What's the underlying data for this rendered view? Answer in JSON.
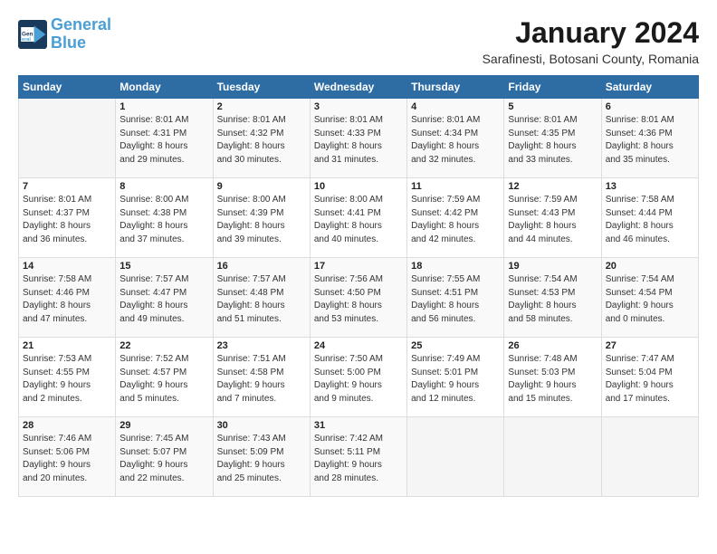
{
  "header": {
    "logo_line1": "General",
    "logo_line2": "Blue",
    "month_title": "January 2024",
    "subtitle": "Sarafinesti, Botosani County, Romania"
  },
  "weekdays": [
    "Sunday",
    "Monday",
    "Tuesday",
    "Wednesday",
    "Thursday",
    "Friday",
    "Saturday"
  ],
  "weeks": [
    [
      {
        "day": "",
        "info": ""
      },
      {
        "day": "1",
        "info": "Sunrise: 8:01 AM\nSunset: 4:31 PM\nDaylight: 8 hours\nand 29 minutes."
      },
      {
        "day": "2",
        "info": "Sunrise: 8:01 AM\nSunset: 4:32 PM\nDaylight: 8 hours\nand 30 minutes."
      },
      {
        "day": "3",
        "info": "Sunrise: 8:01 AM\nSunset: 4:33 PM\nDaylight: 8 hours\nand 31 minutes."
      },
      {
        "day": "4",
        "info": "Sunrise: 8:01 AM\nSunset: 4:34 PM\nDaylight: 8 hours\nand 32 minutes."
      },
      {
        "day": "5",
        "info": "Sunrise: 8:01 AM\nSunset: 4:35 PM\nDaylight: 8 hours\nand 33 minutes."
      },
      {
        "day": "6",
        "info": "Sunrise: 8:01 AM\nSunset: 4:36 PM\nDaylight: 8 hours\nand 35 minutes."
      }
    ],
    [
      {
        "day": "7",
        "info": "Sunrise: 8:01 AM\nSunset: 4:37 PM\nDaylight: 8 hours\nand 36 minutes."
      },
      {
        "day": "8",
        "info": "Sunrise: 8:00 AM\nSunset: 4:38 PM\nDaylight: 8 hours\nand 37 minutes."
      },
      {
        "day": "9",
        "info": "Sunrise: 8:00 AM\nSunset: 4:39 PM\nDaylight: 8 hours\nand 39 minutes."
      },
      {
        "day": "10",
        "info": "Sunrise: 8:00 AM\nSunset: 4:41 PM\nDaylight: 8 hours\nand 40 minutes."
      },
      {
        "day": "11",
        "info": "Sunrise: 7:59 AM\nSunset: 4:42 PM\nDaylight: 8 hours\nand 42 minutes."
      },
      {
        "day": "12",
        "info": "Sunrise: 7:59 AM\nSunset: 4:43 PM\nDaylight: 8 hours\nand 44 minutes."
      },
      {
        "day": "13",
        "info": "Sunrise: 7:58 AM\nSunset: 4:44 PM\nDaylight: 8 hours\nand 46 minutes."
      }
    ],
    [
      {
        "day": "14",
        "info": "Sunrise: 7:58 AM\nSunset: 4:46 PM\nDaylight: 8 hours\nand 47 minutes."
      },
      {
        "day": "15",
        "info": "Sunrise: 7:57 AM\nSunset: 4:47 PM\nDaylight: 8 hours\nand 49 minutes."
      },
      {
        "day": "16",
        "info": "Sunrise: 7:57 AM\nSunset: 4:48 PM\nDaylight: 8 hours\nand 51 minutes."
      },
      {
        "day": "17",
        "info": "Sunrise: 7:56 AM\nSunset: 4:50 PM\nDaylight: 8 hours\nand 53 minutes."
      },
      {
        "day": "18",
        "info": "Sunrise: 7:55 AM\nSunset: 4:51 PM\nDaylight: 8 hours\nand 56 minutes."
      },
      {
        "day": "19",
        "info": "Sunrise: 7:54 AM\nSunset: 4:53 PM\nDaylight: 8 hours\nand 58 minutes."
      },
      {
        "day": "20",
        "info": "Sunrise: 7:54 AM\nSunset: 4:54 PM\nDaylight: 9 hours\nand 0 minutes."
      }
    ],
    [
      {
        "day": "21",
        "info": "Sunrise: 7:53 AM\nSunset: 4:55 PM\nDaylight: 9 hours\nand 2 minutes."
      },
      {
        "day": "22",
        "info": "Sunrise: 7:52 AM\nSunset: 4:57 PM\nDaylight: 9 hours\nand 5 minutes."
      },
      {
        "day": "23",
        "info": "Sunrise: 7:51 AM\nSunset: 4:58 PM\nDaylight: 9 hours\nand 7 minutes."
      },
      {
        "day": "24",
        "info": "Sunrise: 7:50 AM\nSunset: 5:00 PM\nDaylight: 9 hours\nand 9 minutes."
      },
      {
        "day": "25",
        "info": "Sunrise: 7:49 AM\nSunset: 5:01 PM\nDaylight: 9 hours\nand 12 minutes."
      },
      {
        "day": "26",
        "info": "Sunrise: 7:48 AM\nSunset: 5:03 PM\nDaylight: 9 hours\nand 15 minutes."
      },
      {
        "day": "27",
        "info": "Sunrise: 7:47 AM\nSunset: 5:04 PM\nDaylight: 9 hours\nand 17 minutes."
      }
    ],
    [
      {
        "day": "28",
        "info": "Sunrise: 7:46 AM\nSunset: 5:06 PM\nDaylight: 9 hours\nand 20 minutes."
      },
      {
        "day": "29",
        "info": "Sunrise: 7:45 AM\nSunset: 5:07 PM\nDaylight: 9 hours\nand 22 minutes."
      },
      {
        "day": "30",
        "info": "Sunrise: 7:43 AM\nSunset: 5:09 PM\nDaylight: 9 hours\nand 25 minutes."
      },
      {
        "day": "31",
        "info": "Sunrise: 7:42 AM\nSunset: 5:11 PM\nDaylight: 9 hours\nand 28 minutes."
      },
      {
        "day": "",
        "info": ""
      },
      {
        "day": "",
        "info": ""
      },
      {
        "day": "",
        "info": ""
      }
    ]
  ]
}
